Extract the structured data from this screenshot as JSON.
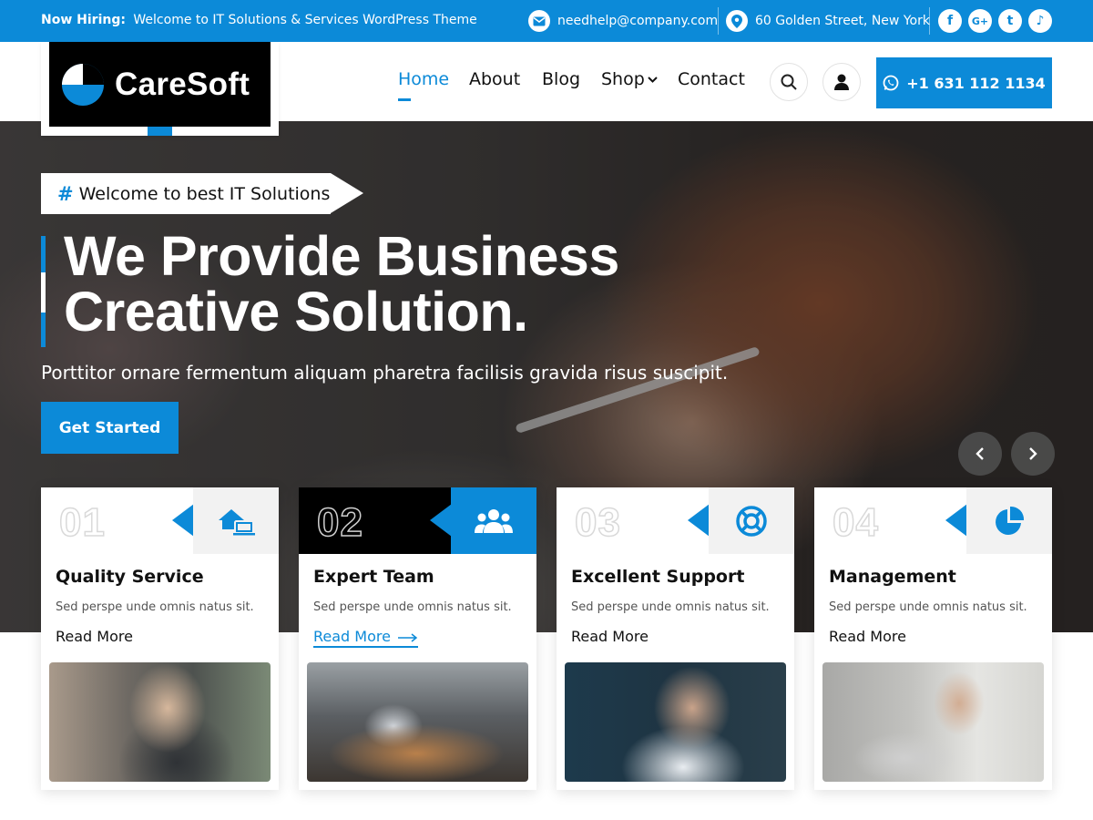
{
  "topbar": {
    "hiring_label": "Now Hiring:",
    "hiring_text": "Welcome to IT Solutions & Services WordPress Theme",
    "email": "needhelp@company.com",
    "address": "60 Golden Street, New York",
    "social": [
      {
        "icon": "facebook-icon",
        "glyph": "f"
      },
      {
        "icon": "google-plus-icon",
        "glyph": "G+"
      },
      {
        "icon": "twitter-icon",
        "glyph": "t"
      },
      {
        "icon": "tiktok-icon",
        "glyph": "♪"
      }
    ]
  },
  "header": {
    "logo_text": "CareSoft",
    "nav": [
      "Home",
      "About",
      "Blog",
      "Shop",
      "Contact"
    ],
    "active_nav": "Home",
    "phone": "+1 631 112 1134"
  },
  "hero": {
    "tag_hash": "#",
    "tag_text": "Welcome to best IT Solutions",
    "title_line1": "We Provide Business",
    "title_line2": "Creative Solution.",
    "subtitle": "Porttitor ornare fermentum aliquam pharetra facilisis gravida risus suscipit.",
    "cta": "Get Started"
  },
  "cards": [
    {
      "num": "01",
      "title": "Quality Service",
      "desc": "Sed perspe unde omnis natus sit.",
      "link": "Read More",
      "icon": "home-devices-icon"
    },
    {
      "num": "02",
      "title": "Expert Team",
      "desc": "Sed perspe unde omnis natus sit.",
      "link": "Read More",
      "icon": "team-icon"
    },
    {
      "num": "03",
      "title": "Excellent Support",
      "desc": "Sed perspe unde omnis natus sit.",
      "link": "Read More",
      "icon": "lifebuoy-icon"
    },
    {
      "num": "04",
      "title": "Management",
      "desc": "Sed perspe unde omnis natus sit.",
      "link": "Read More",
      "icon": "pie-chart-icon"
    }
  ],
  "colors": {
    "accent": "#0c8ad8",
    "dark": "#000000"
  }
}
